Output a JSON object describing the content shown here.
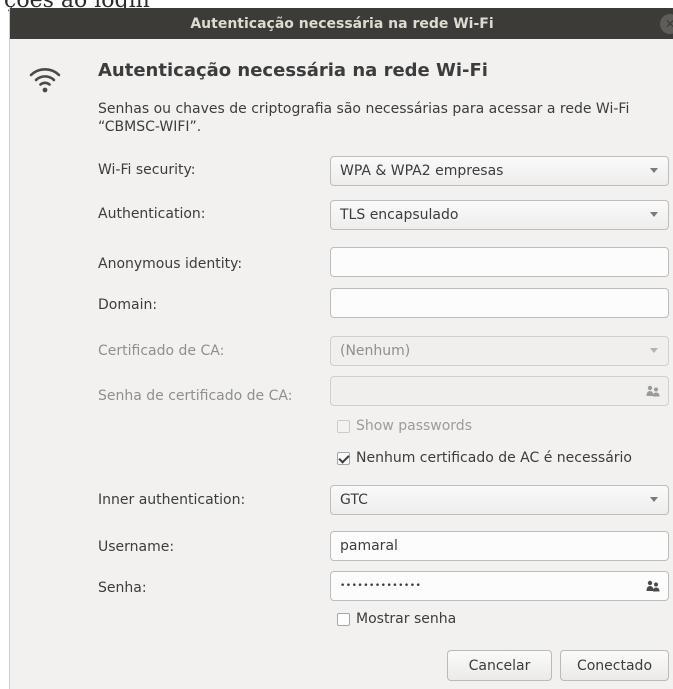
{
  "background": {
    "text": "ções ao login"
  },
  "window": {
    "title": "Autenticação necessária na rede Wi-Fi",
    "close_icon": "close-icon"
  },
  "dialog": {
    "heading": "Autenticação necessária na rede Wi-Fi",
    "description": "Senhas ou chaves de criptografia são necessárias para acessar a rede Wi-Fi “CBMSC-WIFI”.",
    "icon": "wifi-icon"
  },
  "form": {
    "wifi_security": {
      "label": "Wi-Fi security:",
      "value": "WPA & WPA2 empresas"
    },
    "authentication": {
      "label": "Authentication:",
      "value": "TLS encapsulado"
    },
    "anonymous_identity": {
      "label": "Anonymous identity:",
      "value": ""
    },
    "domain": {
      "label": "Domain:",
      "value": ""
    },
    "ca_certificate": {
      "label": "Certificado de CA:",
      "value": "(Nenhum)"
    },
    "ca_cert_password": {
      "label": "Senha de certificado de CA:",
      "value": ""
    },
    "show_passwords": {
      "label": "Show passwords",
      "checked": false
    },
    "no_ca_required": {
      "label": "Nenhum certificado de AC é necessário",
      "checked": true
    },
    "inner_authentication": {
      "label": "Inner authentication:",
      "value": "GTC"
    },
    "username": {
      "label": "Username:",
      "value": "pamaral"
    },
    "password": {
      "label": "Senha:",
      "value": "••••••••••••••"
    },
    "show_password": {
      "label": "Mostrar senha",
      "checked": false
    }
  },
  "buttons": {
    "cancel": "Cancelar",
    "connect": "Conectado"
  },
  "colors": {
    "titlebar": "#3c3b37",
    "dialog_bg": "#f2f1f0",
    "text": "#3c3c3c",
    "dim_text": "#8f8f8f"
  }
}
